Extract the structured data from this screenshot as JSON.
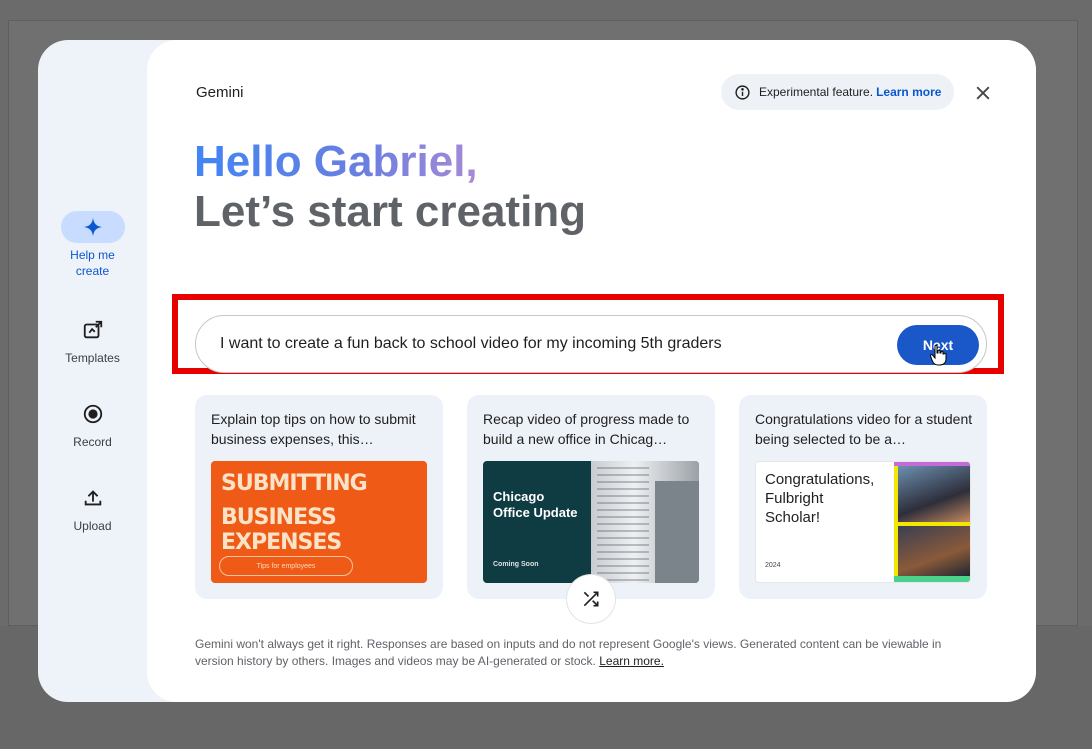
{
  "rail": {
    "items": [
      {
        "label": "Help me create",
        "icon": "sparkle-icon",
        "active": true
      },
      {
        "label": "Templates",
        "icon": "templates-icon",
        "active": false
      },
      {
        "label": "Record",
        "icon": "record-icon",
        "active": false
      },
      {
        "label": "Upload",
        "icon": "upload-icon",
        "active": false
      }
    ]
  },
  "header": {
    "app_name": "Gemini",
    "experimental_text": "Experimental feature.",
    "learn_more": "Learn more",
    "close_icon": "close-icon"
  },
  "greeting": {
    "line1": "Hello Gabriel,",
    "line2": "Let’s start creating"
  },
  "prompt": {
    "value": "I want to create a fun back to school video for my incoming 5th graders",
    "next_label": "Next"
  },
  "suggestions": [
    {
      "text": "Explain top tips on how to submit business expenses, this…",
      "thumb_title_line1": "SUBMITTING",
      "thumb_title_line2": "BUSINESS EXPENSES",
      "thumb_pill": "Tips for employees"
    },
    {
      "text": "Recap video of progress made to build a new office in Chicag…",
      "thumb_title_line1": "Chicago",
      "thumb_title_line2": "Office Update",
      "thumb_footer": "Coming Soon"
    },
    {
      "text": "Congratulations video for a student being selected to be a…",
      "thumb_title_line1": "Congratulations,",
      "thumb_title_line2": "Fulbright",
      "thumb_title_line3": "Scholar!",
      "thumb_year": "2024"
    }
  ],
  "shuffle_icon": "shuffle-icon",
  "disclaimer": {
    "text": "Gemini won't always get it right. Responses are based on inputs and do not represent Google's views. Generated content can be viewable in version history by others. Images and videos may be AI-generated or stock.",
    "link": "Learn more."
  },
  "colors": {
    "accent": "#0b57d0",
    "next_button": "#1a57c9",
    "highlight_border": "#e60000"
  }
}
